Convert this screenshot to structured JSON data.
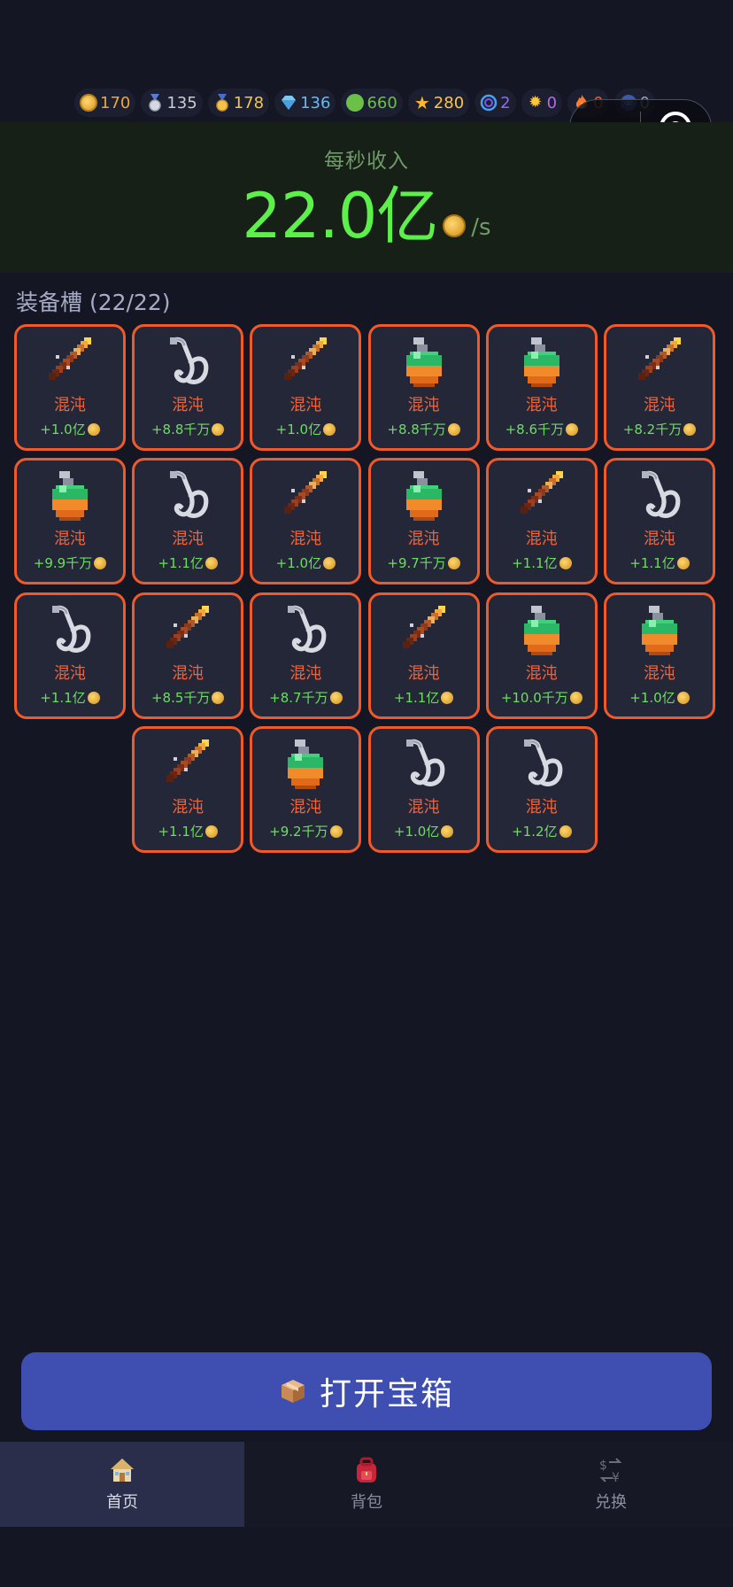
{
  "currencies": [
    {
      "icon": "gold-coin-icon",
      "value": "170",
      "color": "#e9a83a"
    },
    {
      "icon": "silver-medal-icon",
      "value": "135",
      "color": "#c9ccd6"
    },
    {
      "icon": "gold-medal-icon",
      "value": "178",
      "color": "#f2c64a"
    },
    {
      "icon": "diamond-icon",
      "value": "136",
      "color": "#6ab8f2"
    },
    {
      "icon": "green-orb-icon",
      "value": "660",
      "color": "#6cc04a"
    },
    {
      "icon": "star-icon",
      "value": "280",
      "color": "#ffc447"
    },
    {
      "icon": "swirl-icon",
      "value": "2",
      "color": "#8d6cf0"
    },
    {
      "icon": "sun-icon",
      "value": "0",
      "color": "#b56ae6"
    },
    {
      "icon": "fire-icon",
      "value": "0",
      "color": "#f05a2a"
    },
    {
      "icon": "infinity-icon",
      "value": "0",
      "color": "#9aa0b8"
    }
  ],
  "income": {
    "label": "每秒收入",
    "value": "22.0亿",
    "unit": "/s"
  },
  "slots": {
    "title": "装备槽 (22/22)",
    "items": [
      {
        "type": "sword",
        "name": "混沌",
        "bonus": "+1.0亿"
      },
      {
        "type": "hook",
        "name": "混沌",
        "bonus": "+8.8千万"
      },
      {
        "type": "sword",
        "name": "混沌",
        "bonus": "+1.0亿"
      },
      {
        "type": "potion",
        "name": "混沌",
        "bonus": "+8.8千万"
      },
      {
        "type": "potion",
        "name": "混沌",
        "bonus": "+8.6千万"
      },
      {
        "type": "sword",
        "name": "混沌",
        "bonus": "+8.2千万"
      },
      {
        "type": "potion",
        "name": "混沌",
        "bonus": "+9.9千万"
      },
      {
        "type": "hook",
        "name": "混沌",
        "bonus": "+1.1亿"
      },
      {
        "type": "sword",
        "name": "混沌",
        "bonus": "+1.0亿"
      },
      {
        "type": "potion",
        "name": "混沌",
        "bonus": "+9.7千万"
      },
      {
        "type": "sword",
        "name": "混沌",
        "bonus": "+1.1亿"
      },
      {
        "type": "hook",
        "name": "混沌",
        "bonus": "+1.1亿"
      },
      {
        "type": "hook",
        "name": "混沌",
        "bonus": "+1.1亿"
      },
      {
        "type": "sword",
        "name": "混沌",
        "bonus": "+8.5千万"
      },
      {
        "type": "hook",
        "name": "混沌",
        "bonus": "+8.7千万"
      },
      {
        "type": "sword",
        "name": "混沌",
        "bonus": "+1.1亿"
      },
      {
        "type": "potion",
        "name": "混沌",
        "bonus": "+10.0千万"
      },
      {
        "type": "potion",
        "name": "混沌",
        "bonus": "+1.0亿"
      },
      {
        "type": "sword",
        "name": "混沌",
        "bonus": "+1.1亿"
      },
      {
        "type": "potion",
        "name": "混沌",
        "bonus": "+9.2千万"
      },
      {
        "type": "hook",
        "name": "混沌",
        "bonus": "+1.0亿"
      },
      {
        "type": "hook",
        "name": "混沌",
        "bonus": "+1.2亿"
      }
    ]
  },
  "open_chest_button": {
    "label": "打开宝箱",
    "icon": "chest-box-icon"
  },
  "tabs": [
    {
      "label": "首页",
      "icon": "home-icon",
      "active": true
    },
    {
      "label": "背包",
      "icon": "backpack-icon",
      "active": false
    },
    {
      "label": "兑换",
      "icon": "exchange-icon",
      "active": false
    }
  ],
  "colors": {
    "slot_border": "#f05a2a",
    "income_value": "#5ef04a",
    "button": "#3f4eb1"
  }
}
